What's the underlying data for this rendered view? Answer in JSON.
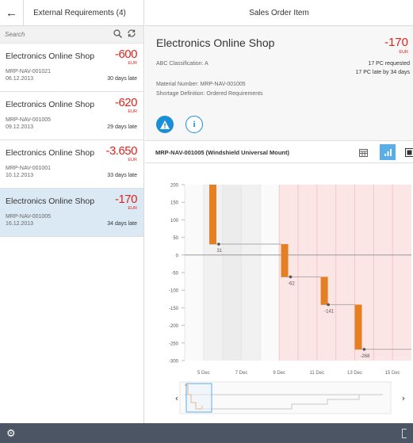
{
  "master": {
    "title": "External Requirements (4)",
    "search_placeholder": "Search",
    "items": [
      {
        "name": "Electronics Online Shop",
        "amount": "-600",
        "currency": "EUR",
        "material": "MRP-NAV-001021",
        "date": "06.12.2013",
        "late": "30 days late"
      },
      {
        "name": "Electronics Online Shop",
        "amount": "-620",
        "currency": "EUR",
        "material": "MRP-NAV-001005",
        "date": "09.12.2013",
        "late": "29 days late"
      },
      {
        "name": "Electronics Online Shop",
        "amount": "-3.650",
        "currency": "EUR",
        "material": "MRP-NAV-001001",
        "date": "10.12.2013",
        "late": "33 days late"
      },
      {
        "name": "Electronics Online Shop",
        "amount": "-170",
        "currency": "EUR",
        "material": "MRP-NAV-001005",
        "date": "16.12.2013",
        "late": "34 days late"
      }
    ]
  },
  "detail": {
    "title": "Sales Order Item",
    "object": {
      "title": "Electronics Online Shop",
      "amount": "-170",
      "currency": "EUR",
      "abc": "ABC Classification: A",
      "requested": "17 PC requested",
      "late": "17 PC late by 34 days",
      "material": "Material Number: MRP-NAV-001005",
      "shortage": "Shortage Definition: Ordered Requirements"
    },
    "chart_title": "MRP-NAV-001005 (Windshield Universal Mount)"
  },
  "colors": {
    "accent": "#1a8fd6",
    "negative": "#e0241b",
    "bar": "#e67e22",
    "shortage_bg": "#fbe5e5",
    "selected_bg": "#dbe9f5",
    "footer": "#4b5563"
  },
  "chart_data": {
    "type": "bar",
    "ylim": [
      -300,
      200
    ],
    "yticks": [
      "200",
      "150",
      "100",
      "50",
      "0",
      "-50",
      "-100",
      "-150",
      "-200",
      "-250",
      "-300"
    ],
    "xticks": [
      "5 Dec",
      "7 Dec",
      "9 Dec",
      "11 Dec",
      "13 Dec",
      "15 Dec"
    ],
    "x_range": [
      4,
      16
    ],
    "bars": [
      {
        "day": 5.3,
        "from": 200,
        "to": 31
      },
      {
        "day": 9.1,
        "from": 31,
        "to": -62
      },
      {
        "day": 11.2,
        "from": -62,
        "to": -141
      },
      {
        "day": 13.0,
        "from": -141,
        "to": -268
      }
    ],
    "points": [
      {
        "day": 5.8,
        "value": 31,
        "label": "31"
      },
      {
        "day": 9.6,
        "value": -62,
        "label": "-62"
      },
      {
        "day": 11.6,
        "value": -141,
        "label": "-141"
      },
      {
        "day": 13.5,
        "value": -268,
        "label": "-268"
      }
    ],
    "shortage_from_day": 9.0
  }
}
